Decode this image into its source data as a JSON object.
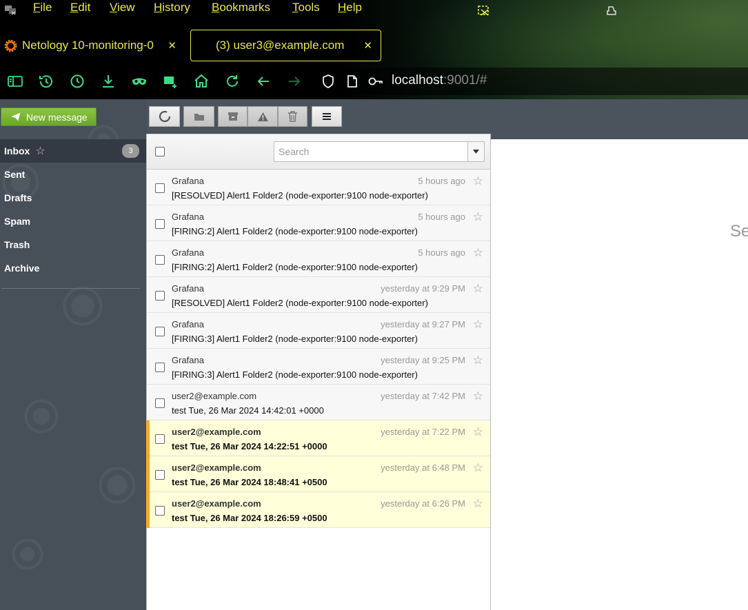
{
  "menu": [
    "File",
    "Edit",
    "View",
    "History",
    "Bookmarks",
    "Tools",
    "Help"
  ],
  "tabs": [
    {
      "title": "Netology 10-monitoring-0",
      "icon": "grafana-icon",
      "active": false
    },
    {
      "title": "(3) user3@example.com",
      "icon": "",
      "active": true
    }
  ],
  "url": {
    "host": "localhost",
    "rest": ":9001/#"
  },
  "compose_label": "New message",
  "folders": [
    {
      "name": "Inbox",
      "count": "3"
    },
    {
      "name": "Sent"
    },
    {
      "name": "Drafts"
    },
    {
      "name": "Spam"
    },
    {
      "name": "Trash"
    },
    {
      "name": "Archive"
    }
  ],
  "search_placeholder": "Search",
  "messages": [
    {
      "from": "Grafana",
      "subject": "[RESOLVED] Alert1 Folder2 (node-exporter:9100 node-exporter)",
      "date": "5 hours ago",
      "unread": false
    },
    {
      "from": "Grafana",
      "subject": "[FIRING:2] Alert1 Folder2 (node-exporter:9100 node-exporter)",
      "date": "5 hours ago",
      "unread": false
    },
    {
      "from": "Grafana",
      "subject": "[FIRING:2] Alert1 Folder2 (node-exporter:9100 node-exporter)",
      "date": "5 hours ago",
      "unread": false
    },
    {
      "from": "Grafana",
      "subject": "[RESOLVED] Alert1 Folder2 (node-exporter:9100 node-exporter)",
      "date": "yesterday at 9:29 PM",
      "unread": false
    },
    {
      "from": "Grafana",
      "subject": "[FIRING:3] Alert1 Folder2 (node-exporter:9100 node-exporter)",
      "date": "yesterday at 9:27 PM",
      "unread": false
    },
    {
      "from": "Grafana",
      "subject": "[FIRING:3] Alert1 Folder2 (node-exporter:9100 node-exporter)",
      "date": "yesterday at 9:25 PM",
      "unread": false
    },
    {
      "from": "user2@example.com",
      "subject": "test Tue, 26 Mar 2024 14:42:01 +0000",
      "date": "yesterday at 7:42 PM",
      "unread": false
    },
    {
      "from": "user2@example.com",
      "subject": "test Tue, 26 Mar 2024 14:22:51 +0000",
      "date": "yesterday at 7:22 PM",
      "unread": true
    },
    {
      "from": "user2@example.com",
      "subject": "test Tue, 26 Mar 2024 18:48:41 +0500",
      "date": "yesterday at 6:48 PM",
      "unread": true
    },
    {
      "from": "user2@example.com",
      "subject": "test Tue, 26 Mar 2024 18:26:59 +0500",
      "date": "yesterday at 6:26 PM",
      "unread": true
    }
  ],
  "preview_partial_label": "Se",
  "colors": {
    "menu_text": "#e8e84a",
    "compose": "#7ab433",
    "unread_bg": "#ffffd9",
    "unread_marker": "#f9a825"
  }
}
